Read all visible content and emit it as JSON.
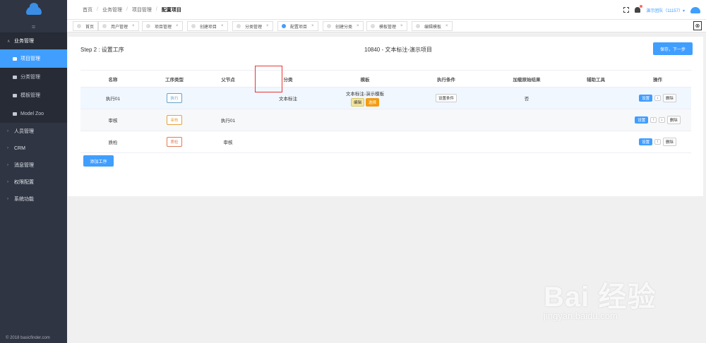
{
  "sidebar": {
    "menu_icon": "hamburger-icon",
    "groups": [
      {
        "label": "业务管理",
        "open": true
      },
      {
        "label": "人员管理"
      },
      {
        "label": "CRM"
      },
      {
        "label": "消息管理"
      },
      {
        "label": "权限配置"
      },
      {
        "label": "系统功能"
      }
    ],
    "items": [
      {
        "label": "项目管理",
        "active": true
      },
      {
        "label": "分类管理"
      },
      {
        "label": "模板管理"
      },
      {
        "label": "Model Zoo"
      }
    ],
    "footer": "© 2018 basicfinder.com"
  },
  "header": {
    "breadcrumb": [
      "首页",
      "业务管理",
      "项目管理",
      "配置项目"
    ],
    "team_label": "演示团队（11157）▾"
  },
  "tabs": [
    {
      "label": "首页"
    },
    {
      "label": "用户管理"
    },
    {
      "label": "项目管理"
    },
    {
      "label": "创建项目"
    },
    {
      "label": "分类管理"
    },
    {
      "label": "配置项目",
      "active": true
    },
    {
      "label": "创建分类"
    },
    {
      "label": "模板管理"
    },
    {
      "label": "编辑模板"
    }
  ],
  "tab_close_glyph": "×",
  "tab_close_all": "⊗",
  "page": {
    "step": "Step 2 : 设置工序",
    "project": "10840 - 文本标注-演示项目",
    "save_next": "保存，下一步",
    "add_process": "添加工序"
  },
  "table": {
    "columns": [
      "名称",
      "工序类型",
      "父节点",
      "分类",
      "模板",
      "执行条件",
      "加载原始结果",
      "辅助工具",
      "操作"
    ],
    "rows": [
      {
        "name": "执行01",
        "type": "执行",
        "type_color": "blue",
        "parent": "",
        "category": "文本标注",
        "template": "文本标注-演示模板",
        "template_edit": "编辑",
        "template_pick": "选择",
        "condition": "设置条件",
        "load_original": "否",
        "tools": "",
        "op_set": "设置",
        "op_down": "↓",
        "op_delete": "删除"
      },
      {
        "name": "审核",
        "type": "审核",
        "type_color": "orange",
        "parent": "执行01",
        "category": "",
        "template": "",
        "condition": "",
        "load_original": "",
        "tools": "",
        "op_set": "设置",
        "op_up": "↑",
        "op_down": "↓",
        "op_delete": "删除"
      },
      {
        "name": "质检",
        "type": "质检",
        "type_color": "red",
        "parent": "审核",
        "category": "",
        "template": "",
        "condition": "",
        "load_original": "",
        "tools": "",
        "op_set": "设置",
        "op_up": "↑",
        "op_delete": "删除"
      }
    ]
  },
  "watermark": {
    "brand": "Bai 经验",
    "url": "jingyan.baidu.com"
  },
  "colors": {
    "primary": "#409eff",
    "sidebar_bg": "#2f3542",
    "pick": "#f39c12",
    "highlight": "#e33333"
  }
}
